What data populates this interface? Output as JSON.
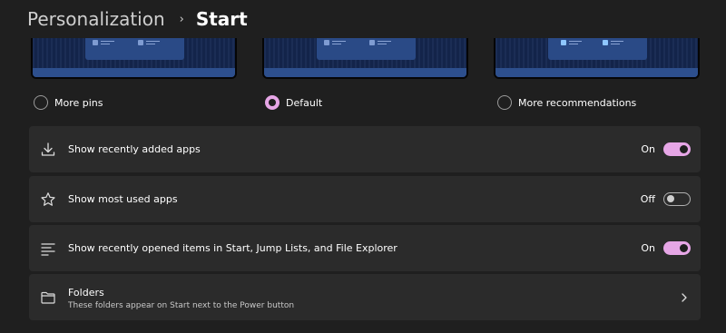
{
  "breadcrumb": {
    "parent": "Personalization",
    "separator": "›",
    "current": "Start"
  },
  "layout_options": [
    {
      "label": "More pins",
      "selected": false
    },
    {
      "label": "Default",
      "selected": true
    },
    {
      "label": "More recommendations",
      "selected": false
    }
  ],
  "settings": {
    "recently_added": {
      "label": "Show recently added apps",
      "state": "On",
      "on": true,
      "icon": "download-icon"
    },
    "most_used": {
      "label": "Show most used apps",
      "state": "Off",
      "on": false,
      "icon": "star-icon"
    },
    "recently_opened": {
      "label": "Show recently opened items in Start, Jump Lists, and File Explorer",
      "state": "On",
      "on": true,
      "icon": "list-icon"
    },
    "folders": {
      "title": "Folders",
      "subtitle": "These folders appear on Start next to the Power button",
      "icon": "folder-icon"
    }
  },
  "colors": {
    "accent": "#e6a6e6",
    "background": "#1f1f1f",
    "card": "#2b2b2b",
    "preview_bg": "#14264a"
  }
}
